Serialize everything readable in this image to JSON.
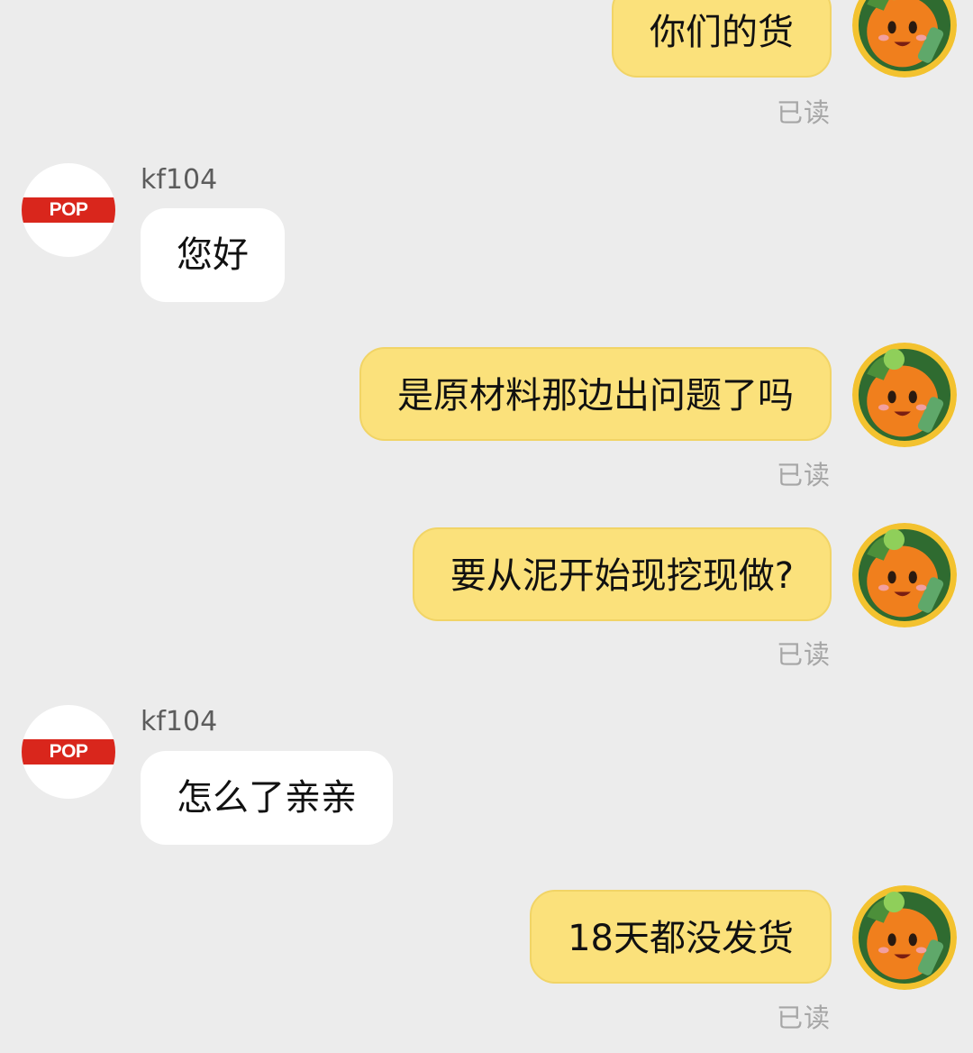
{
  "conversation": {
    "messages": [
      {
        "role": "self",
        "text": "你们的货",
        "status": "已读"
      },
      {
        "role": "other",
        "sender": "kf104",
        "text": "您好",
        "avatar_text": "POP MART"
      },
      {
        "role": "self",
        "text": "是原材料那边出问题了吗",
        "status": "已读"
      },
      {
        "role": "self",
        "text": "要从泥开始现挖现做?",
        "status": "已读"
      },
      {
        "role": "other",
        "sender": "kf104",
        "text": "怎么了亲亲",
        "avatar_text": "POP MART"
      },
      {
        "role": "self",
        "text": "18天都没发货",
        "status": "已读"
      }
    ]
  },
  "colors": {
    "background": "#ececec",
    "self_bubble": "#fbe17b",
    "other_bubble": "#ffffff",
    "brand_red": "#d9261c"
  }
}
